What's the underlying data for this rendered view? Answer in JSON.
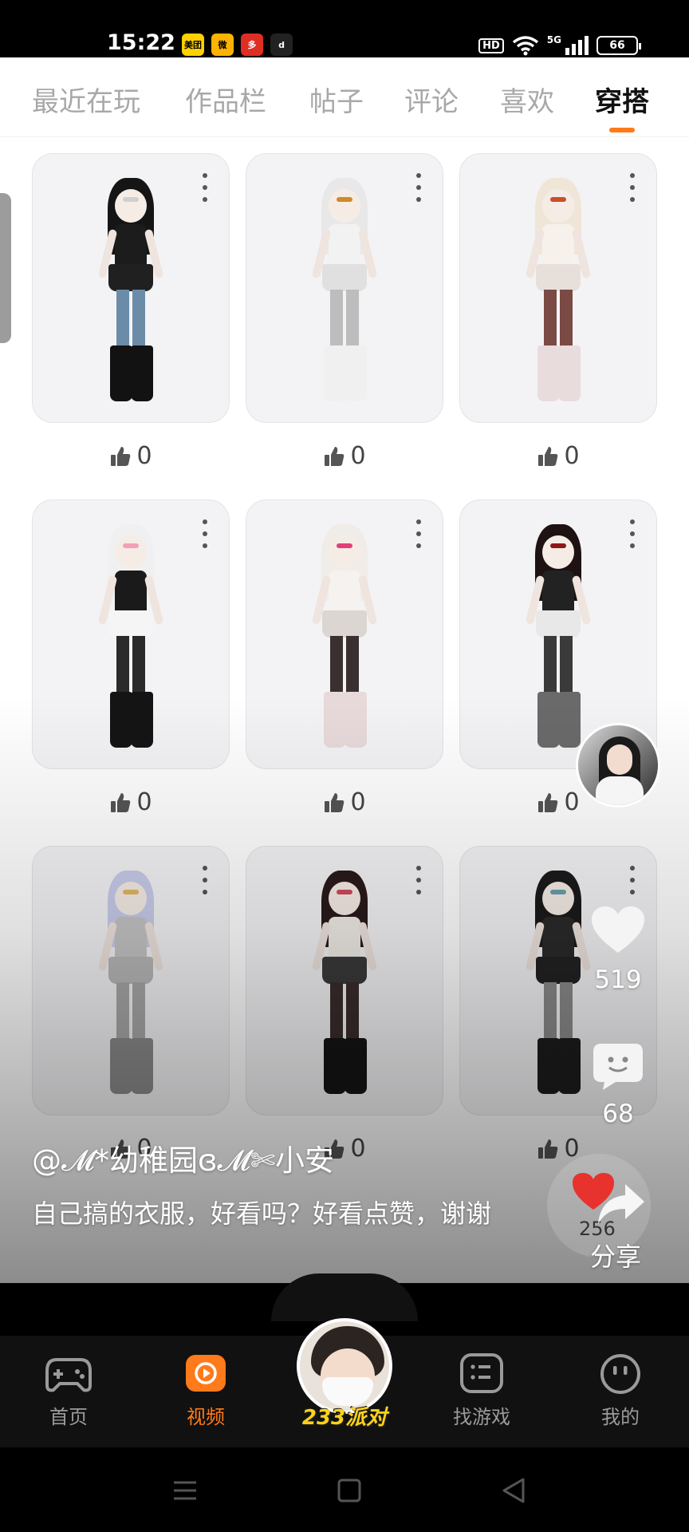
{
  "status_bar": {
    "time": "15:22",
    "apps": [
      {
        "name": "meituan-icon",
        "label": "美团",
        "color": "#ffd100"
      },
      {
        "name": "weibo-icon",
        "label": "微",
        "color": "#ffb300"
      },
      {
        "name": "pinduoduo-icon",
        "label": "多",
        "color": "#e02e24"
      },
      {
        "name": "douyin-icon",
        "label": "d",
        "color": "#222222"
      }
    ],
    "hd": "HD",
    "network": "5G",
    "battery": "66"
  },
  "tabs": [
    {
      "label": "最近在玩",
      "active": false
    },
    {
      "label": "作品栏",
      "active": false
    },
    {
      "label": "帖子",
      "active": false
    },
    {
      "label": "评论",
      "active": false
    },
    {
      "label": "喜欢",
      "active": false
    },
    {
      "label": "穿搭",
      "active": true
    }
  ],
  "outfits": [
    {
      "likes": "0",
      "hair": "#151515",
      "top": "#1c1c1c",
      "skirt": "#202020",
      "legs": "#6a8ca8",
      "boots": "#121212",
      "accent": "#cfcfcf"
    },
    {
      "likes": "0",
      "hair": "#e8e8e8",
      "top": "#f2f2f2",
      "skirt": "#e0e0e0",
      "legs": "#bdbdbd",
      "boots": "#f0f0f0",
      "accent": "#d08a2a"
    },
    {
      "likes": "0",
      "hair": "#f0e6d8",
      "top": "#f7f1ec",
      "skirt": "#e7e0da",
      "legs": "#7a4a45",
      "boots": "#e8dcdc",
      "accent": "#c8502a"
    },
    {
      "likes": "0",
      "hair": "#f0f0f0",
      "top": "#1a1a1a",
      "skirt": "#f5f5f5",
      "legs": "#2a2a2a",
      "boots": "#141414",
      "accent": "#f2a0b8"
    },
    {
      "likes": "0",
      "hair": "#f0ece8",
      "top": "#f5f2f0",
      "skirt": "#dcd6d2",
      "legs": "#3a3030",
      "boots": "#e8dada",
      "accent": "#e0407a"
    },
    {
      "likes": "0",
      "hair": "#1e1212",
      "top": "#222222",
      "skirt": "#e8e8e8",
      "legs": "#3a3a3a",
      "boots": "#6a6a6a",
      "accent": "#8a1a1a"
    },
    {
      "likes": "0",
      "hair": "#c8ccea",
      "top": "#c4c4c4",
      "skirt": "#b8b8b8",
      "legs": "#a8a8a8",
      "boots": "#8a8a8a",
      "accent": "#e0b860"
    },
    {
      "likes": "0",
      "hair": "#2a1a1a",
      "top": "#f0ece6",
      "skirt": "#3a3a3a",
      "legs": "#3a2c2c",
      "boots": "#141414",
      "accent": "#d04a5a"
    },
    {
      "likes": "0",
      "hair": "#1a1a1a",
      "top": "#2a2a2a",
      "skirt": "#222222",
      "legs": "#8a8a8a",
      "boots": "#1c1c1c",
      "accent": "#6aa0aa"
    }
  ],
  "video": {
    "username": "@𝓜*幼稚园ɞ𝓜✄小安",
    "description": "自己搞的衣服，好看吗？好看点赞，谢谢",
    "like_count": "519",
    "comment_count": "68",
    "share_label": "分享",
    "share_like_count": "256"
  },
  "bottom_nav": {
    "items": [
      {
        "label": "首页",
        "active": false
      },
      {
        "label": "视频",
        "active": true
      },
      {
        "label": "找游戏",
        "active": false
      },
      {
        "label": "我的",
        "active": false
      }
    ],
    "center_label": "233派对"
  },
  "colors": {
    "accent": "#ff7a1a",
    "nav_bg": "#111111"
  }
}
